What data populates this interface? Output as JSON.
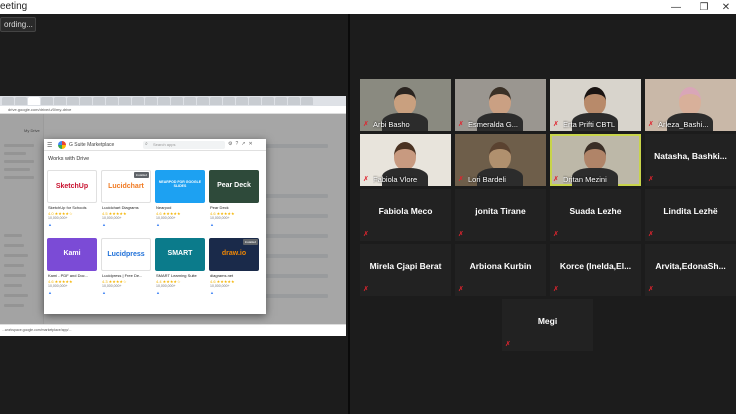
{
  "window": {
    "title": "eeting",
    "minimize": "—",
    "maximize": "❐",
    "close": "✕"
  },
  "recording": {
    "label": "ording..."
  },
  "share": {
    "address": "drive.google.com/drive/u/0/my-drive",
    "drive_title": "My Drive",
    "status_url": "...workspace.google.com/marketplace/app/...",
    "marketplace": {
      "title": "G Suite Marketplace",
      "search_placeholder": "Search apps",
      "section": "Works with Drive",
      "apps": [
        {
          "name": "SketchUp for Schools",
          "banner": "SketchUp",
          "rating": "4.0 ★★★★☆",
          "users": "10,000,000+",
          "bg": "#ffffff",
          "fg": "#c8102e"
        },
        {
          "name": "Lucidchart Diagrams",
          "banner": "Lucidchart",
          "rating": "4.5 ★★★★★",
          "users": "10,000,000+",
          "bg": "#ffffff",
          "fg": "#f07a22",
          "installed": "Installed"
        },
        {
          "name": "Nearpod",
          "banner": "NEARPOD FOR GOOGLE SLIDES",
          "rating": "4.6 ★★★★★",
          "users": "10,000,000+",
          "bg": "#1da1f2",
          "fg": "#ffffff"
        },
        {
          "name": "Pear Deck",
          "banner": "Pear Deck",
          "rating": "4.6 ★★★★★",
          "users": "10,000,000+",
          "bg": "#2e4a3a",
          "fg": "#ffffff"
        },
        {
          "name": "Kami - PDF and Doc...",
          "banner": "Kami",
          "rating": "4.6 ★★★★★",
          "users": "10,000,000+",
          "bg": "#7b4bd6",
          "fg": "#ffffff"
        },
        {
          "name": "Lucidpress | Free De...",
          "banner": "Lucidpress",
          "rating": "4.3 ★★★★☆",
          "users": "10,000,000+",
          "bg": "#ffffff",
          "fg": "#1d6fd8"
        },
        {
          "name": "SMART Learning Suite",
          "banner": "SMART",
          "rating": "4.4 ★★★★☆",
          "users": "10,000,000+",
          "bg": "#0b7b8b",
          "fg": "#ffffff"
        },
        {
          "name": "diagrams.net",
          "banner": "draw.io",
          "rating": "4.6 ★★★★★",
          "users": "10,000,000+",
          "bg": "#1a2a4a",
          "fg": "#f08705",
          "installed": "Installed"
        }
      ]
    }
  },
  "participants": [
    {
      "name": "Arbi Basho",
      "video": true,
      "skin": "#c9a07f",
      "hair": "#2a2420",
      "bg": "#8a8a80"
    },
    {
      "name": "Esmeralda G...",
      "video": true,
      "skin": "#caa083",
      "hair": "#3a3026",
      "bg": "#9a9690"
    },
    {
      "name": "Erta Prifti CBTL",
      "video": true,
      "skin": "#b88a6a",
      "hair": "#1a1412",
      "bg": "#d8d4cc"
    },
    {
      "name": "Arleza_Bashi...",
      "video": true,
      "skin": "#d8b09a",
      "hair": "#d9a6b8",
      "bg": "#c9b8a8"
    },
    {
      "name": "Fabiola Vlore",
      "video": true,
      "skin": "#c89a80",
      "hair": "#4a3222",
      "bg": "#e8e4dc"
    },
    {
      "name": "Lori Bardeli",
      "video": true,
      "skin": "#b0906e",
      "hair": "#5a4230",
      "bg": "#6e5e4a"
    },
    {
      "name": "Dritan Mezini",
      "video": true,
      "active": true,
      "skin": "#b08468",
      "hair": "#3a2e26",
      "bg": "#bdb8a8"
    },
    {
      "name": "Natasha,  Bashki...",
      "video": false
    },
    {
      "name": "Fabiola Meco",
      "video": false
    },
    {
      "name": "jonita Tirane",
      "video": false
    },
    {
      "name": "Suada Lezhe",
      "video": false
    },
    {
      "name": "Lindita Lezhë",
      "video": false
    },
    {
      "name": "Mirela Cjapi Berat",
      "video": false
    },
    {
      "name": "Arbiona  Kurbin",
      "video": false
    },
    {
      "name": "Korce  (Inelda,El...",
      "video": false
    },
    {
      "name": "Arvita,EdonaSh...",
      "video": false
    },
    {
      "name": "Megi",
      "video": false
    }
  ],
  "colors": {
    "mic_muted": "#e0242f",
    "active_speaker": "#c8d44a",
    "tile_bg": "#222222"
  }
}
